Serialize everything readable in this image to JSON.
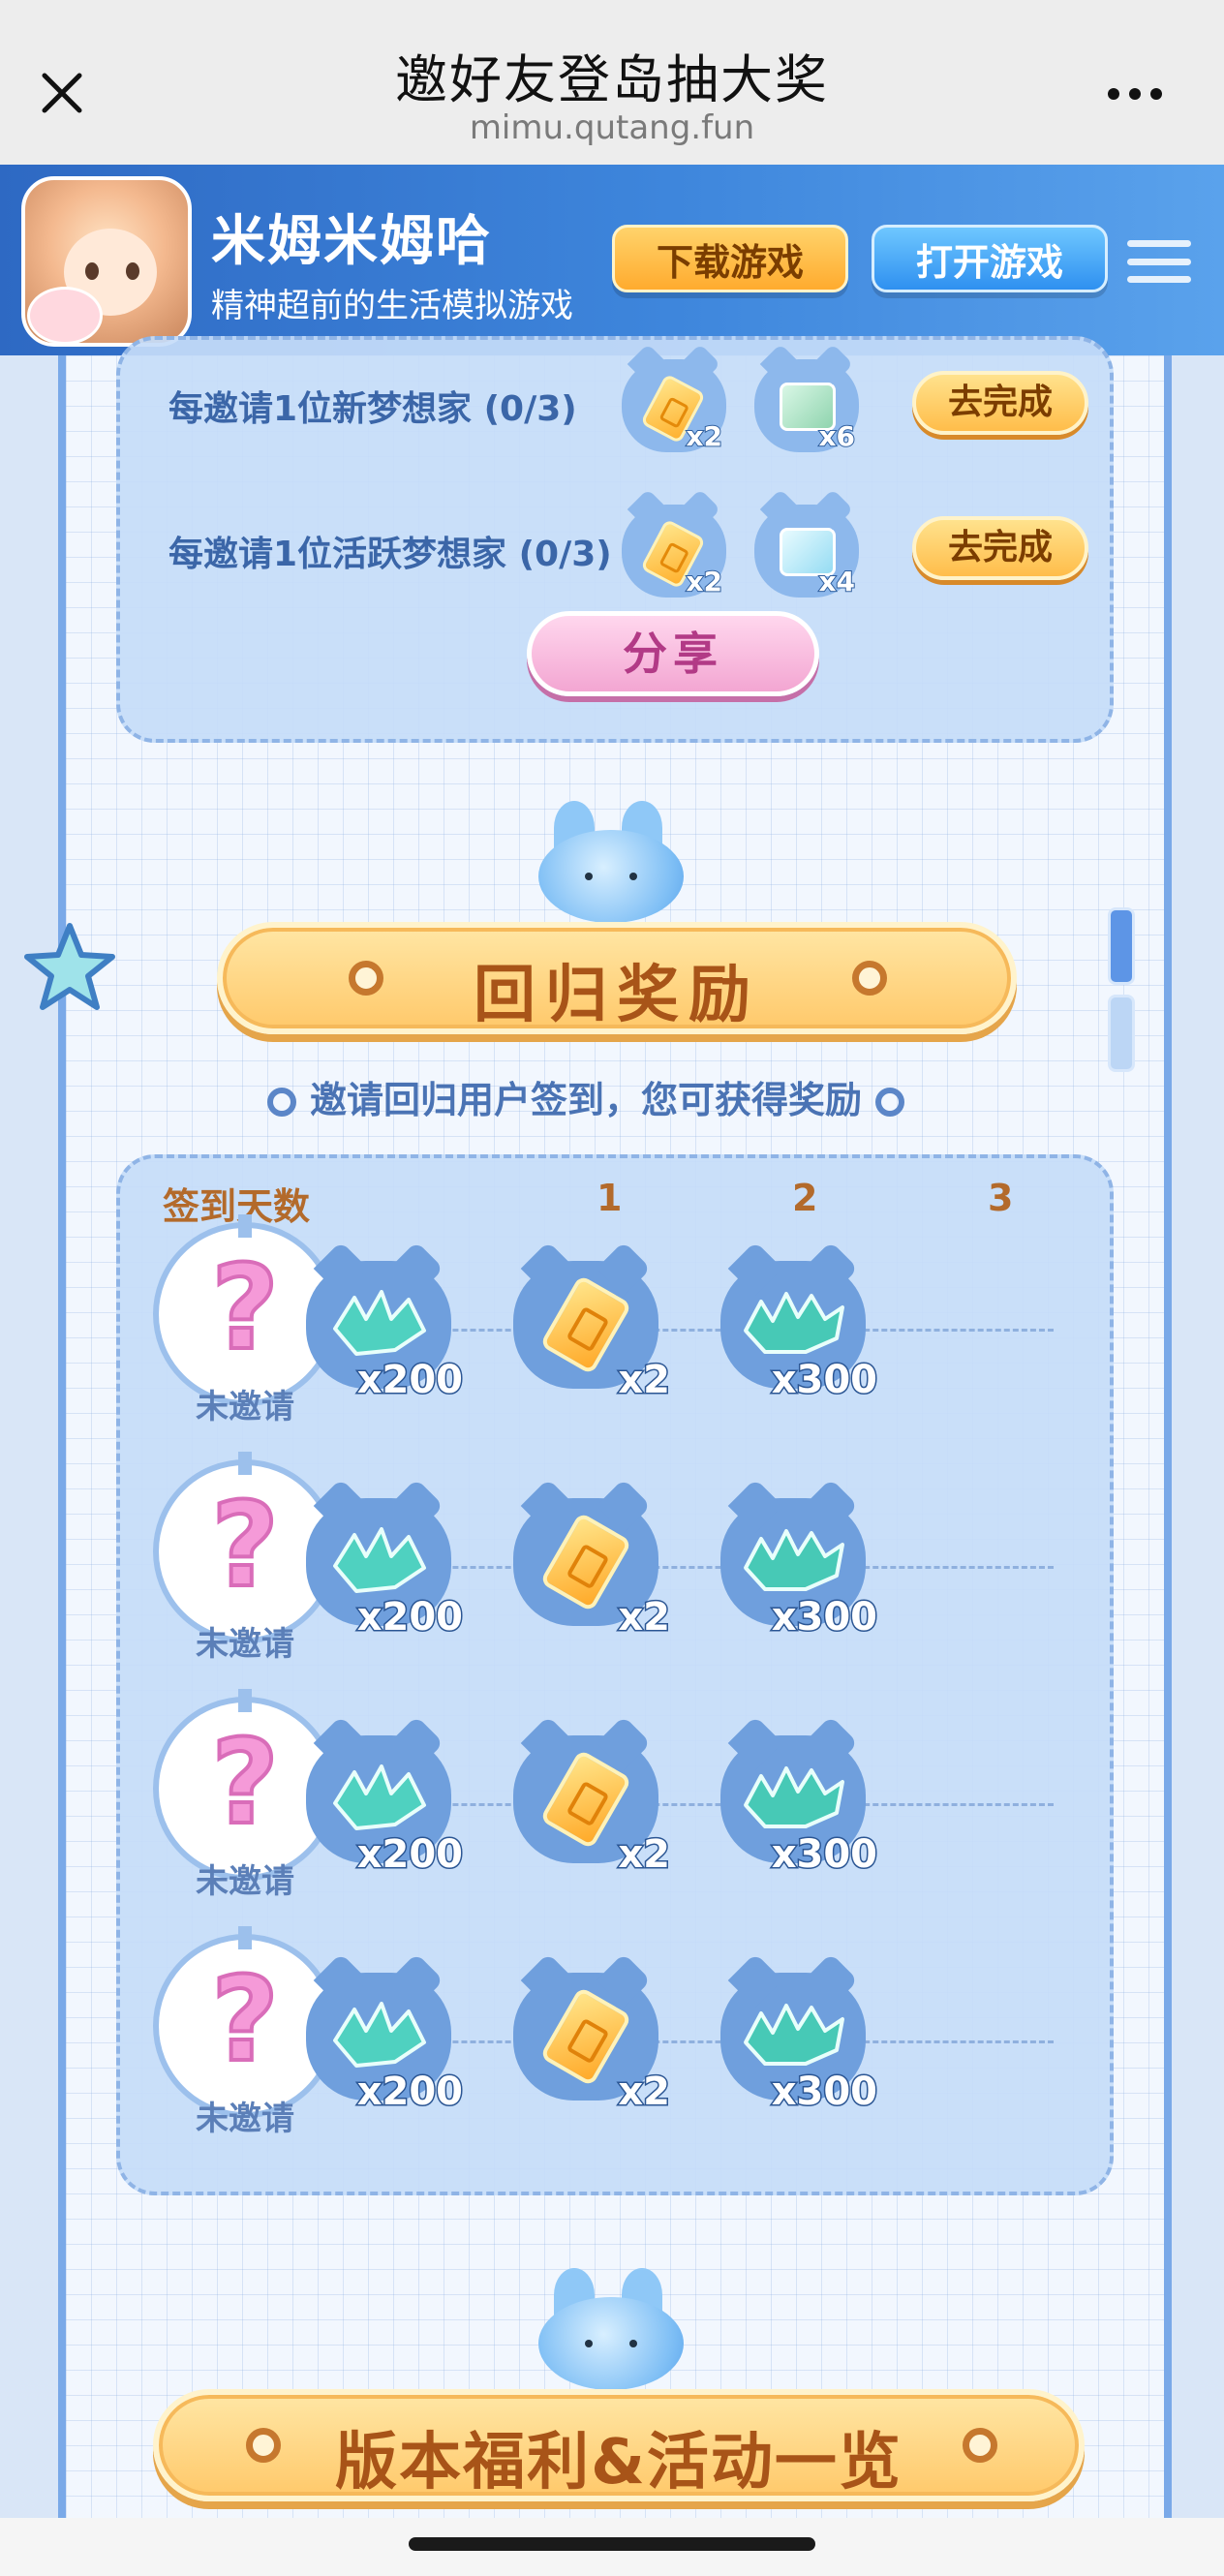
{
  "browser": {
    "title": "邀好友登岛抽大奖",
    "url": "mimu.qutang.fun"
  },
  "banner": {
    "app_name": "米姆米姆哈",
    "app_desc": "精神超前的生活模拟游戏",
    "download_label": "下载游戏",
    "open_label": "打开游戏"
  },
  "tasks": [
    {
      "label": "每邀请1位新梦想家 (0/3)",
      "rewards": [
        {
          "icon": "ticket-icon",
          "count": "x2"
        },
        {
          "icon": "green-card-icon",
          "count": "x6"
        }
      ],
      "button": "去完成"
    },
    {
      "label": "每邀请1位活跃梦想家 (0/3)",
      "rewards": [
        {
          "icon": "ticket-icon",
          "count": "x2"
        },
        {
          "icon": "ice-card-icon",
          "count": "x4"
        }
      ],
      "button": "去完成"
    }
  ],
  "share_label": "分享",
  "return_section": {
    "title": "回归奖励",
    "subtitle": "邀请回归用户签到，您可获得奖励",
    "col_days": "签到天数",
    "col_1": "1",
    "col_2": "2",
    "col_3": "3",
    "rows": [
      {
        "status": "未邀请",
        "r1": "x200",
        "r2": "x2",
        "r3": "x300"
      },
      {
        "status": "未邀请",
        "r1": "x200",
        "r2": "x2",
        "r3": "x300"
      },
      {
        "status": "未邀请",
        "r1": "x200",
        "r2": "x2",
        "r3": "x300"
      },
      {
        "status": "未邀请",
        "r1": "x200",
        "r2": "x2",
        "r3": "x300"
      }
    ]
  },
  "version_section": {
    "title": "版本福利&活动一览"
  }
}
